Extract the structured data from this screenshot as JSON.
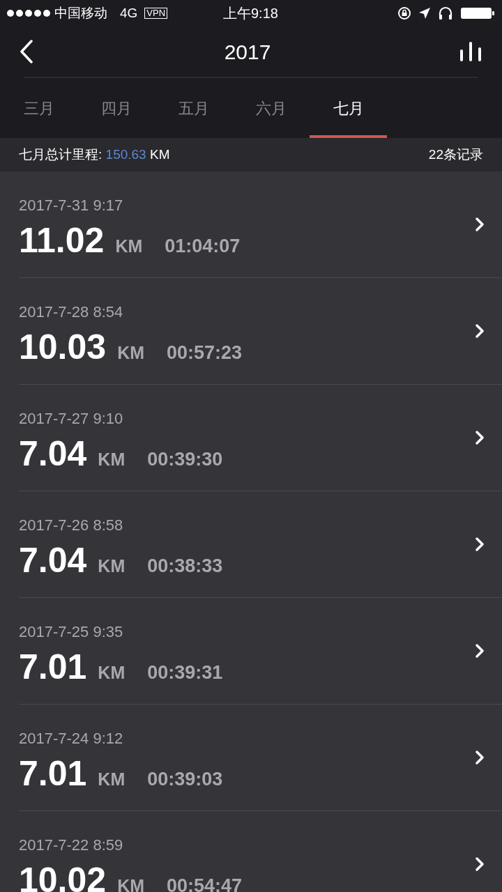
{
  "status_bar": {
    "carrier": "中国移动",
    "network": "4G",
    "vpn": "VPN",
    "time": "上午9:18"
  },
  "header": {
    "title": "2017"
  },
  "tabs": [
    {
      "label": "三月",
      "selected": false
    },
    {
      "label": "四月",
      "selected": false
    },
    {
      "label": "五月",
      "selected": false
    },
    {
      "label": "六月",
      "selected": false
    },
    {
      "label": "七月",
      "selected": true
    }
  ],
  "summary": {
    "label": "七月总计里程: ",
    "distance": "150.63",
    "unit": " KM",
    "count": "22条记录"
  },
  "records": [
    {
      "date": "2017-7-31 9:17",
      "distance": "11.02",
      "unit": "KM",
      "duration": "01:04:07"
    },
    {
      "date": "2017-7-28 8:54",
      "distance": "10.03",
      "unit": "KM",
      "duration": "00:57:23"
    },
    {
      "date": "2017-7-27 9:10",
      "distance": "7.04",
      "unit": "KM",
      "duration": "00:39:30"
    },
    {
      "date": "2017-7-26 8:58",
      "distance": "7.04",
      "unit": "KM",
      "duration": "00:38:33"
    },
    {
      "date": "2017-7-25 9:35",
      "distance": "7.01",
      "unit": "KM",
      "duration": "00:39:31"
    },
    {
      "date": "2017-7-24 9:12",
      "distance": "7.01",
      "unit": "KM",
      "duration": "00:39:03"
    },
    {
      "date": "2017-7-22 8:59",
      "distance": "10.02",
      "unit": "KM",
      "duration": "00:54:47"
    }
  ]
}
